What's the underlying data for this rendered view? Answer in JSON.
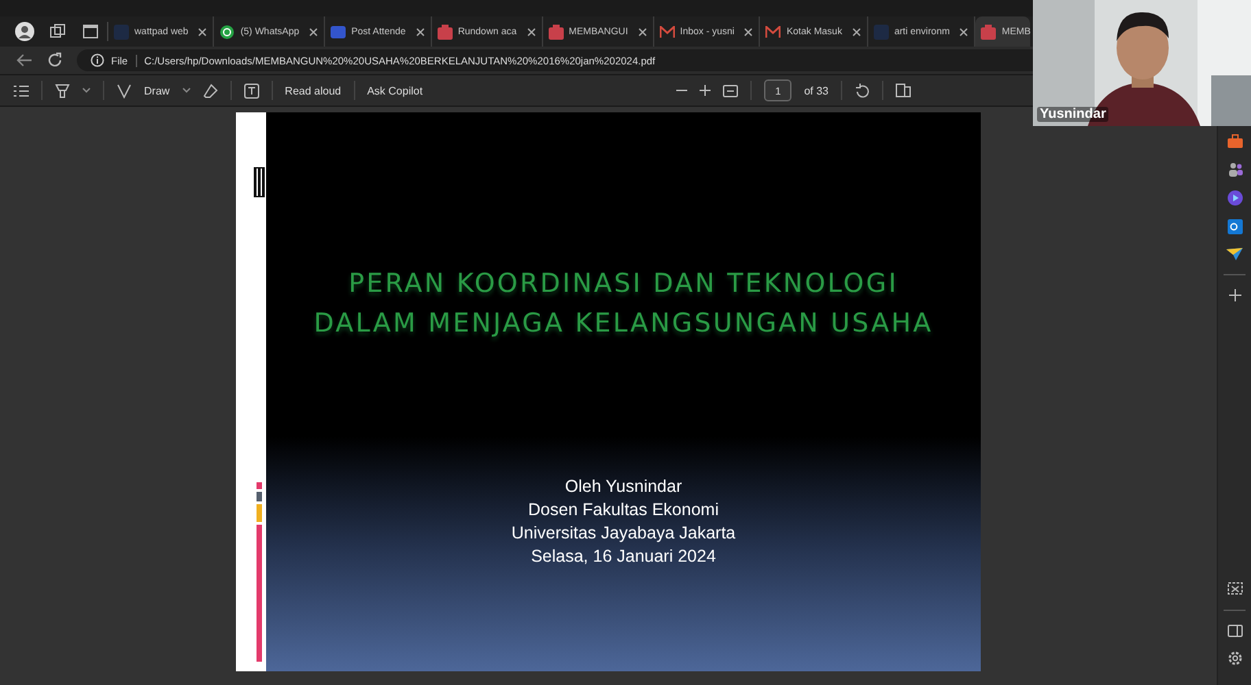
{
  "tabs": [
    {
      "label": "wattpad web",
      "kind": "blank",
      "selected": false
    },
    {
      "label": "(5) WhatsApp",
      "kind": "whatsapp",
      "selected": false
    },
    {
      "label": "Post Attende",
      "kind": "doc",
      "selected": false
    },
    {
      "label": "Rundown aca",
      "kind": "pdf",
      "selected": false
    },
    {
      "label": "MEMBANGUI",
      "kind": "pdf",
      "selected": false
    },
    {
      "label": "Inbox - yusni",
      "kind": "mail",
      "selected": false
    },
    {
      "label": "Kotak Masuk",
      "kind": "mail",
      "selected": false
    },
    {
      "label": "arti environm",
      "kind": "blank",
      "selected": false
    },
    {
      "label": "MEMB",
      "kind": "pdf",
      "selected": true
    }
  ],
  "address": {
    "scheme": "File",
    "url": "C:/Users/hp/Downloads/MEMBANGUN%20%20USAHA%20BERKELANJUTAN%20%2016%20jan%202024.pdf"
  },
  "toolbar": {
    "draw": "Draw",
    "read_aloud": "Read aloud",
    "ask_copilot": "Ask Copilot",
    "page": "1",
    "page_count": "of 33"
  },
  "slide": {
    "title_lines": [
      "PERAN KOORDINASI DAN TEKNOLOGI",
      "DALAM MENJAGA KELANGSUNGAN USAHA"
    ],
    "subtitle_lines": [
      "Oleh Yusnindar",
      "Dosen Fakultas Ekonomi",
      "Universitas Jayabaya Jakarta",
      "Selasa, 16 Januari 2024"
    ]
  },
  "video": {
    "name": "Yusnindar"
  }
}
